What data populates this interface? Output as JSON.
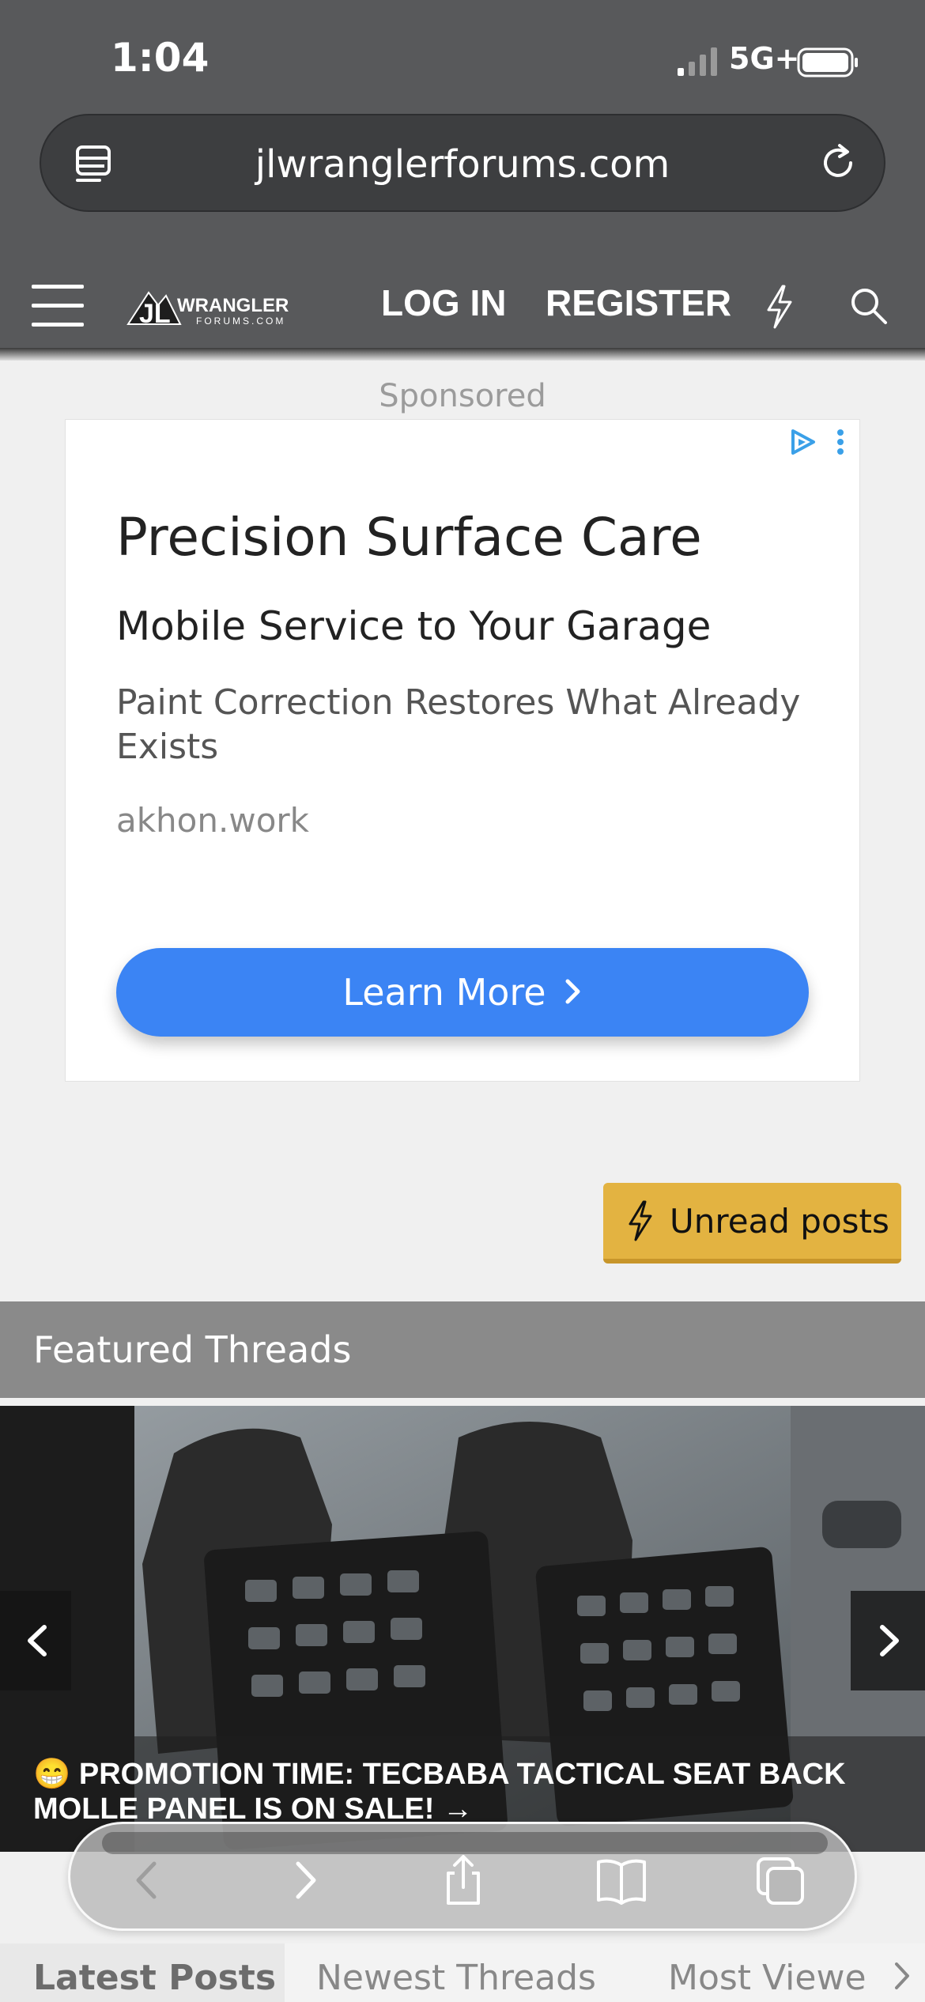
{
  "status_bar": {
    "time": "1:04",
    "network": "5G+"
  },
  "browser": {
    "url": "jlwranglerforums.com"
  },
  "site_nav": {
    "login": "LOG IN",
    "register": "REGISTER",
    "logo_text": "JLWRANGLER FORUMS.COM"
  },
  "ad": {
    "sponsored_label": "Sponsored",
    "title": "Precision Surface Care",
    "subtitle": "Mobile Service to Your Garage",
    "description": "Paint Correction Restores What Already Exists",
    "domain": "akhon.work",
    "cta": "Learn More"
  },
  "unread_posts": {
    "label": "Unread posts",
    "color": "#e3b341"
  },
  "featured": {
    "title": "Featured Threads",
    "caption": "😁 PROMOTION TIME: TECBABA TACTICAL SEAT BACK MOLLE PANEL IS ON SALE!   →"
  },
  "tabs": [
    "Latest Posts",
    "Newest Threads",
    "Most Viewe"
  ],
  "colors": {
    "chrome": "#58595b",
    "accent_blue": "#3b84f4",
    "featured_header": "#8a8a8a"
  },
  "icons": [
    "reader-icon",
    "reload-icon",
    "menu-icon",
    "bolt-icon",
    "search-icon",
    "adchoices-icon",
    "kebab-icon",
    "chevron-left-icon",
    "chevron-right-icon",
    "share-icon",
    "bookmarks-icon",
    "tabs-icon"
  ]
}
